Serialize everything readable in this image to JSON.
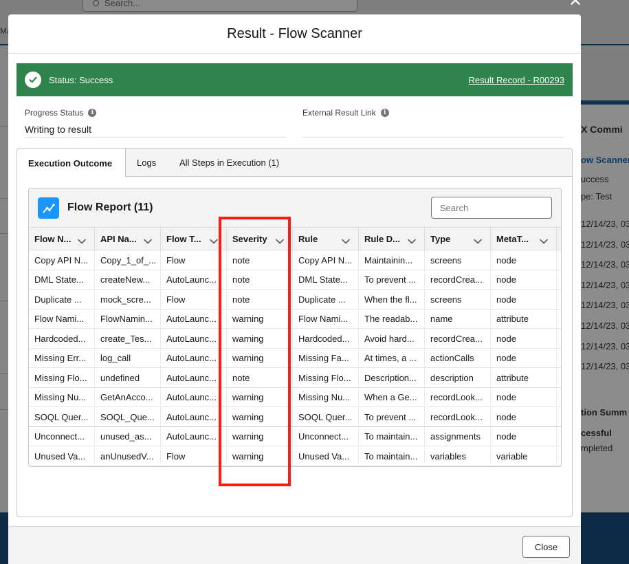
{
  "background": {
    "search_placeholder": "Search...",
    "nav_text": "Ma",
    "panel": {
      "heading": "X Commi",
      "link": "ow Scanner",
      "status": "uccess",
      "type": "pe: Test",
      "dates": [
        "12/14/23, 03",
        "12/14/23, 03",
        "12/14/23, 03",
        "12/14/23, 03",
        "12/14/23, 03",
        "12/14/23, 03",
        "12/14/23, 03",
        "12/14/23, 03"
      ],
      "summary_heading": "tion Summ",
      "summary_status": "cessful",
      "summary_state": "mpleted"
    }
  },
  "modal": {
    "title": "Result - Flow Scanner",
    "status_text": "Status: Success",
    "result_link": "Result Record - R00293",
    "fields": {
      "progress_label": "Progress Status",
      "progress_value": "Writing to result",
      "external_label": "External Result Link",
      "external_value": ""
    },
    "tabs": [
      "Execution Outcome",
      "Logs",
      "All Steps in Execution (1)"
    ],
    "report": {
      "title": "Flow Report (11)",
      "search_placeholder": "Search",
      "columns": [
        "Flow N...",
        "API Na...",
        "Flow T...",
        "Severity",
        "Rule",
        "Rule D...",
        "Type",
        "MetaT..."
      ],
      "rows": [
        [
          "Copy API N...",
          "Copy_1_of_...",
          "Flow",
          "note",
          "Copy API N...",
          "Maintainin...",
          "screens",
          "node"
        ],
        [
          "DML State...",
          "createNew...",
          "AutoLaunc...",
          "note",
          "DML State...",
          "To prevent ...",
          "recordCrea...",
          "node"
        ],
        [
          "Duplicate ...",
          "mock_scre...",
          "Flow",
          "note",
          "Duplicate ...",
          "When the fl...",
          "screens",
          "node"
        ],
        [
          "Flow Nami...",
          "FlowNamin...",
          "AutoLaunc...",
          "warning",
          "Flow Nami...",
          "The readab...",
          "name",
          "attribute"
        ],
        [
          "Hardcoded...",
          "create_Tes...",
          "AutoLaunc...",
          "warning",
          "Hardcoded...",
          "Avoid hard...",
          "recordCrea...",
          "node"
        ],
        [
          "Missing Err...",
          "log_call",
          "AutoLaunc...",
          "warning",
          "Missing Fa...",
          "At times, a ...",
          "actionCalls",
          "node"
        ],
        [
          "Missing Flo...",
          "undefined",
          "AutoLaunc...",
          "note",
          "Missing Flo...",
          "Description...",
          "description",
          "attribute"
        ],
        [
          "Missing Nu...",
          "GetAnAcco...",
          "AutoLaunc...",
          "warning",
          "Missing Nu...",
          "When a Ge...",
          "recordLook...",
          "node"
        ],
        [
          "SOQL Quer...",
          "SOQL_Que...",
          "AutoLaunc...",
          "warning",
          "SOQL Quer...",
          "To prevent ...",
          "recordLook...",
          "node"
        ],
        [
          "Unconnect...",
          "unused_as...",
          "AutoLaunc...",
          "warning",
          "Unconnect...",
          "To maintain...",
          "assignments",
          "node"
        ],
        [
          "Unused Va...",
          "anUnusedV...",
          "Flow",
          "warning",
          "Unused Va...",
          "To maintain...",
          "variables",
          "variable"
        ]
      ]
    },
    "close_label": "Close"
  },
  "colors": {
    "success": "#2e844a",
    "brand_icon": "#1b96ff",
    "highlight": "#ff1a1a"
  }
}
